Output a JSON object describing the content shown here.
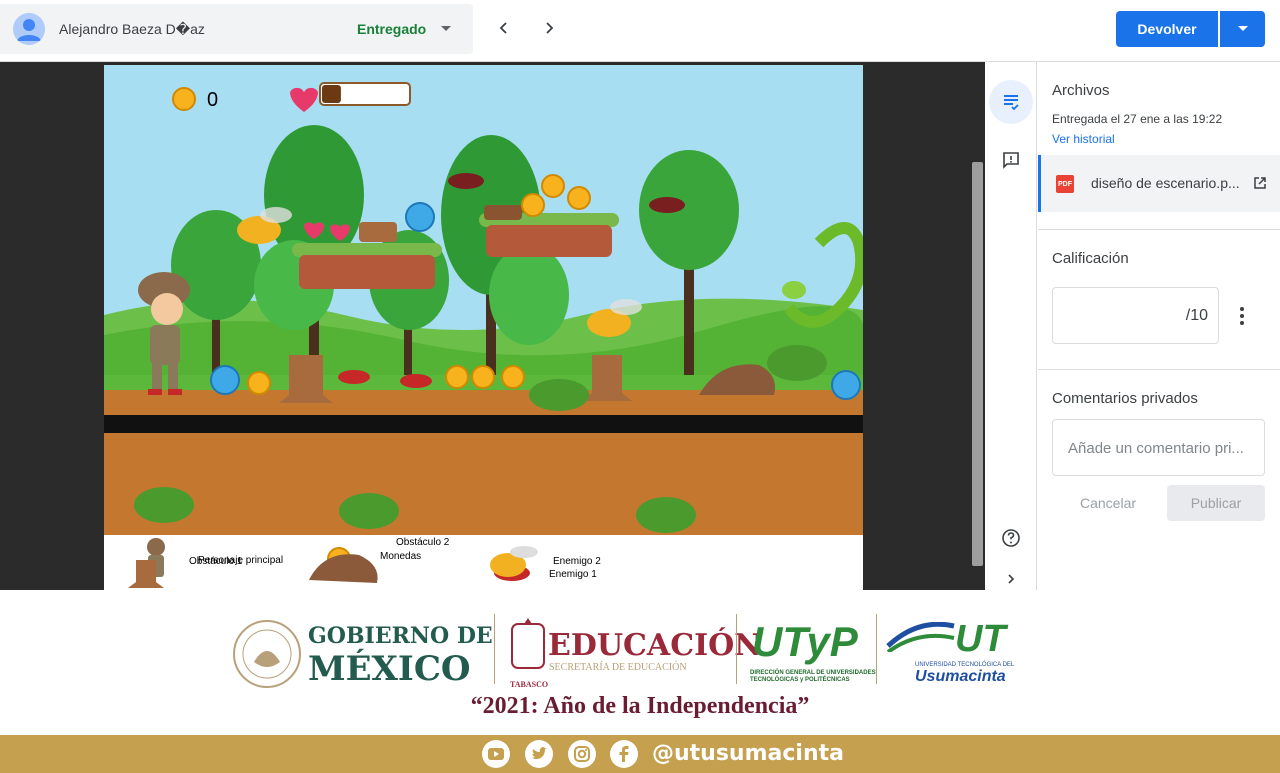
{
  "topbar": {
    "student_name": "Alejandro Baeza D�az",
    "status": "Entregado",
    "return_label": "Devolver"
  },
  "game": {
    "coin_count": "0",
    "health_fraction": 0.08,
    "legend": {
      "main_character": "Personaje principal",
      "coins": "Monedas",
      "enemy1": "Enemigo 1",
      "enemy2": "Enemigo 2",
      "obstacle1": "Obstáculo 1",
      "obstacle2": "Obstáculo 2"
    }
  },
  "panel": {
    "files_title": "Archivos",
    "submitted_info": "Entregada el 27 ene a las 19:22",
    "history_link": "Ver historial",
    "file_badge": "PDF",
    "file_name": "diseño de escenario.p...",
    "grade_title": "Calificación",
    "grade_denominator": "/10",
    "comments_title": "Comentarios privados",
    "comment_placeholder": "Añade un comentario pri...",
    "cancel_label": "Cancelar",
    "publish_label": "Publicar"
  },
  "footer": {
    "gov_line1": "GOBIERNO DE",
    "gov_line2": "MÉXICO",
    "edu_title": "EDUCACIÓN",
    "edu_subtitle": "SECRETARÍA DE EDUCACIÓN",
    "edu_state": "TABASCO",
    "utp_text": "UTyP",
    "utp_caption_1": "DIRECCIÓN GENERAL DE UNIVERSIDADES",
    "utp_caption_2": "TECNOLÓGICAS y POLITÉCNICAS",
    "ut_text": "UT",
    "ut_caption": "UNIVERSIDAD TECNOLÓGICA DEL",
    "ut_name": "Usumacinta",
    "slogan": "“2021: Año de la Independencia”",
    "handle": "@utusumacinta"
  },
  "colors": {
    "primary_blue": "#1a73e8",
    "status_green": "#188038",
    "gov_green": "#235b4e",
    "slogan_maroon": "#691c32",
    "band_gold": "#c4a04f"
  }
}
